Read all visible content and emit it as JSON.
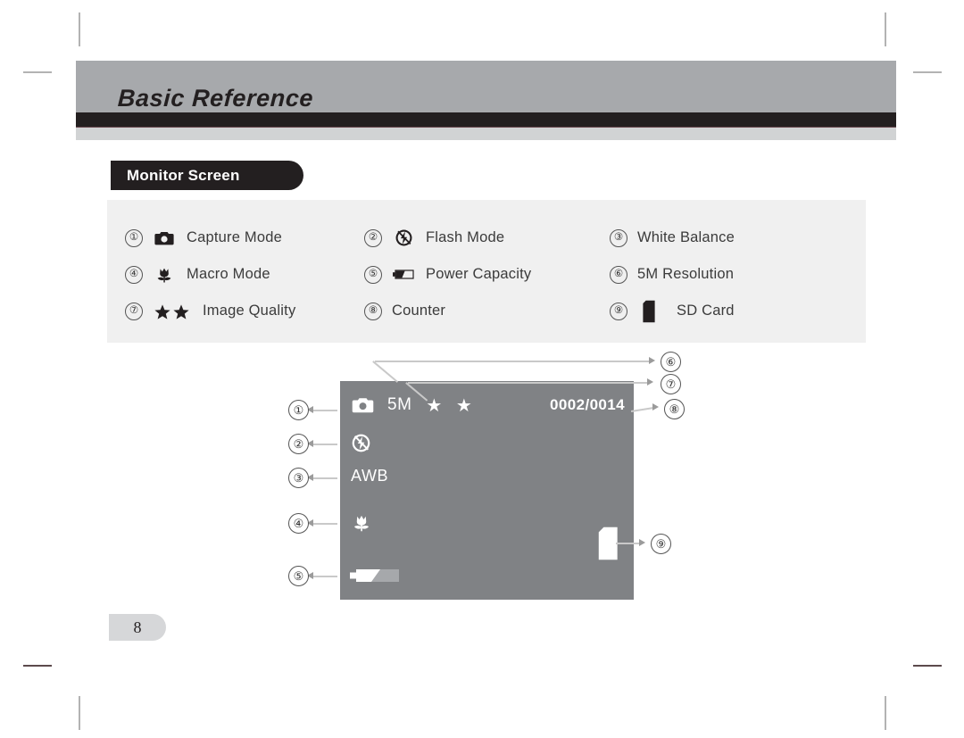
{
  "page": {
    "header_title": "Basic Reference",
    "section_title": "Monitor Screen",
    "page_number": "8"
  },
  "colors": {
    "header_band": "#a7a9ac",
    "header_rule_dark": "#231f20",
    "header_rule_light": "#d1d3d4",
    "legend_panel": "#f0f0f0",
    "lcd_background": "#808285",
    "lcd_foreground": "#ffffff",
    "leader_line": "#c9c9c9",
    "page_number_pill": "#d6d7d9"
  },
  "legend": {
    "items": [
      {
        "number": "①",
        "icon": "camera-icon",
        "label": "Capture Mode"
      },
      {
        "number": "②",
        "icon": "flash-off-icon",
        "label": "Flash  Mode"
      },
      {
        "number": "③",
        "icon": "none",
        "label": "White Balance"
      },
      {
        "number": "④",
        "icon": "macro-tulip-icon",
        "label": "Macro Mode"
      },
      {
        "number": "⑤",
        "icon": "battery-icon",
        "label": "Power Capacity"
      },
      {
        "number": "⑥",
        "icon": "none",
        "label": "5M Resolution"
      },
      {
        "number": "⑦",
        "icon": "two-stars-icon",
        "label": "Image Quality"
      },
      {
        "number": "⑧",
        "icon": "none",
        "label": "Counter"
      },
      {
        "number": "⑨",
        "icon": "sd-card-icon",
        "label": "SD Card"
      }
    ]
  },
  "lcd": {
    "resolution": "5M",
    "quality_stars": "★ ★",
    "counter": "0002/0014",
    "white_balance": "AWB",
    "icons": {
      "capture": "camera-icon",
      "flash": "flash-off-icon",
      "macro": "macro-tulip-icon",
      "battery": "battery-icon",
      "sd_card": "sd-card-icon"
    },
    "callouts": {
      "c1": "①",
      "c2": "②",
      "c3": "③",
      "c4": "④",
      "c5": "⑤",
      "c6": "⑥",
      "c7": "⑦",
      "c8": "⑧",
      "c9": "⑨"
    }
  }
}
